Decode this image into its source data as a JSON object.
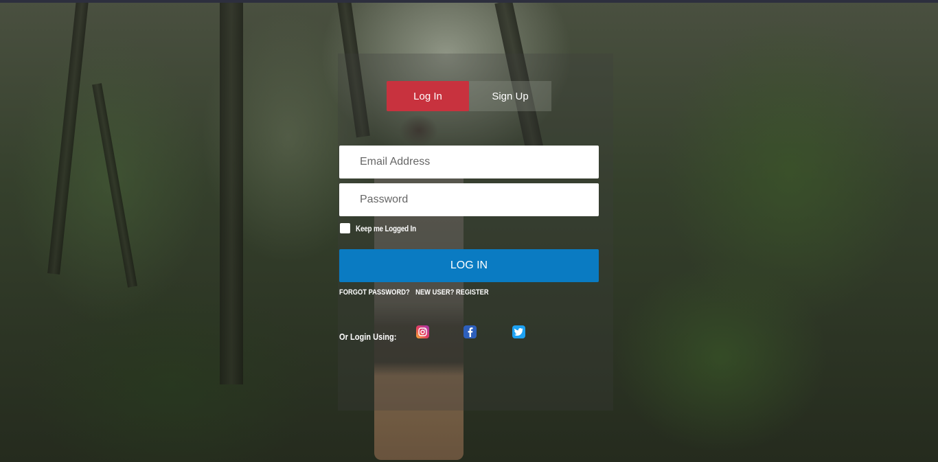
{
  "auth_tabs": {
    "login_label": "Log In",
    "signup_label": "Sign Up",
    "active": "login"
  },
  "form": {
    "email_placeholder": "Email Address",
    "email_value": "",
    "password_placeholder": "Password",
    "password_value": "",
    "remember_label": "Keep me Logged In",
    "remember_checked": false,
    "submit_label": "LOG IN"
  },
  "links": {
    "forgot_password": "FORGOT PASSWORD?",
    "register": "NEW USER? REGISTER"
  },
  "social": {
    "label": "Or Login Using:",
    "providers": [
      {
        "icon": "instagram-icon",
        "color": "#e4405f"
      },
      {
        "icon": "facebook-icon",
        "color": "#2d5fbb"
      },
      {
        "icon": "twitter-icon",
        "color": "#1da1f2"
      }
    ]
  },
  "colors": {
    "active_tab": "#c8323e",
    "login_button": "#0a7bc2"
  }
}
